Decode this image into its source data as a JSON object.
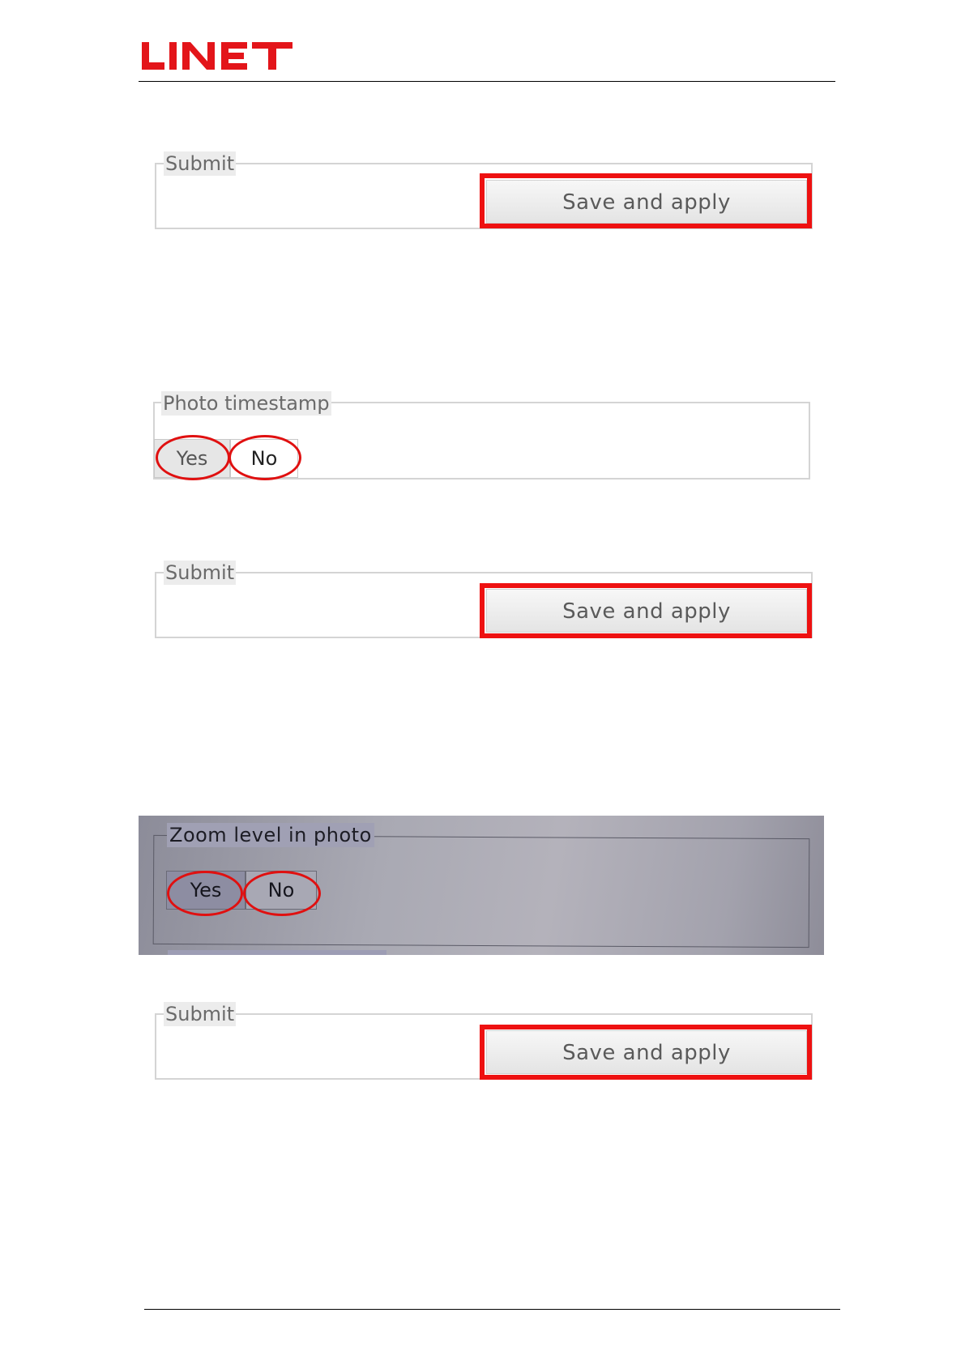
{
  "header": {
    "logo_text": "LINET",
    "logo_color": "#e3151a"
  },
  "section1": {
    "legend": "Submit",
    "button_label": "Save and apply"
  },
  "section2": {
    "legend": "Photo timestamp",
    "options": [
      "Yes",
      "No"
    ]
  },
  "section3": {
    "legend": "Submit",
    "button_label": "Save and apply"
  },
  "section4": {
    "legend": "Zoom level in photo",
    "options": [
      "Yes",
      "No"
    ]
  },
  "section5": {
    "legend": "Submit",
    "button_label": "Save and apply"
  },
  "annotation_color": "#ee1111"
}
